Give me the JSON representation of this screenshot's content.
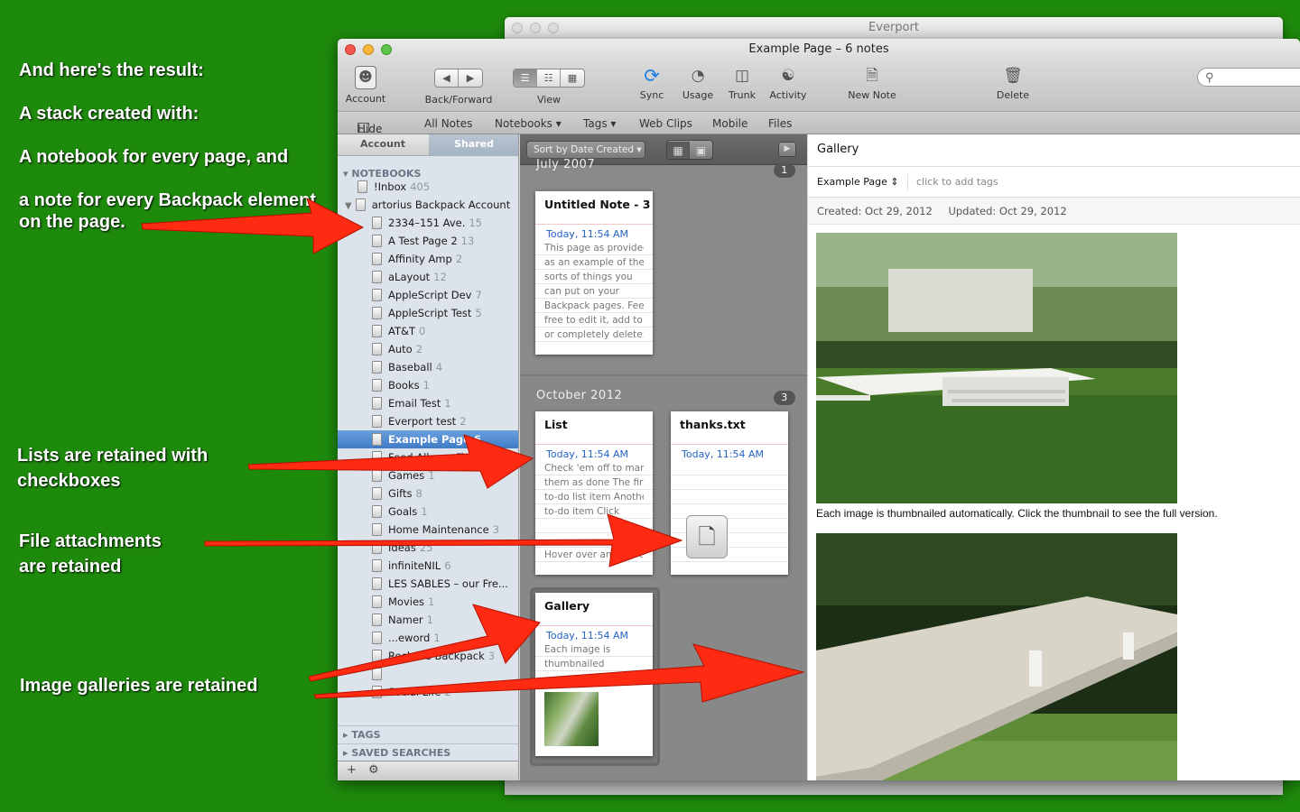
{
  "annotations": {
    "a1": "And here's the result:",
    "a2": "A stack created with:",
    "a3": "A notebook for every page, and",
    "a4": "a note for every Backpack element",
    "a4b": "on the page.",
    "a5": "Lists are retained with",
    "a5b": "checkboxes",
    "a6": "File attachments",
    "a6b": "are retained",
    "a7": "Image galleries are retained"
  },
  "bg_window": {
    "title": "Everport"
  },
  "window": {
    "title": "Example Page – 6 notes"
  },
  "toolbar": {
    "account": "Account",
    "backforward": "Back/Forward",
    "view": "View",
    "sync": "Sync",
    "usage": "Usage",
    "trunk": "Trunk",
    "activity": "Activity",
    "new_note": "New Note",
    "delete": "Delete"
  },
  "navbar": {
    "hide": "Hide",
    "all_notes": "All Notes",
    "notebooks": "Notebooks ▾",
    "tags": "Tags ▾",
    "web_clips": "Web Clips",
    "mobile": "Mobile",
    "files": "Files"
  },
  "sidebar": {
    "tab_account": "Account",
    "tab_shared": "Shared",
    "notebooks_header": "NOTEBOOKS",
    "tags_header": "TAGS",
    "saved_searches_header": "SAVED SEARCHES",
    "inbox": {
      "label": "!Inbox",
      "count": "405"
    },
    "stack": "artorius Backpack Account",
    "notebooks": [
      {
        "label": "2334–151 Ave.",
        "count": "15"
      },
      {
        "label": "A Test Page 2",
        "count": "13"
      },
      {
        "label": "Affinity Amp",
        "count": "2"
      },
      {
        "label": "aLayout",
        "count": "12"
      },
      {
        "label": "AppleScript Dev",
        "count": "7"
      },
      {
        "label": "AppleScript Test",
        "count": "5"
      },
      {
        "label": "AT&T",
        "count": "0"
      },
      {
        "label": "Auto",
        "count": "2"
      },
      {
        "label": "Baseball",
        "count": "4"
      },
      {
        "label": "Books",
        "count": "1"
      },
      {
        "label": "Email Test",
        "count": "1"
      },
      {
        "label": "Everport test",
        "count": "2"
      },
      {
        "label": "Example Page",
        "count": "6"
      },
      {
        "label": "Food Allergy Finder",
        "count": ""
      },
      {
        "label": "Games",
        "count": "1"
      },
      {
        "label": "Gifts",
        "count": "8"
      },
      {
        "label": "Goals",
        "count": "1"
      },
      {
        "label": "Home Maintenance",
        "count": "3"
      },
      {
        "label": "Ideas",
        "count": "25"
      },
      {
        "label": "infiniteNIL",
        "count": "6"
      },
      {
        "label": "LES SABLES – our Fre...",
        "count": ""
      },
      {
        "label": "Movies",
        "count": "1"
      },
      {
        "label": "Namer",
        "count": "1"
      },
      {
        "label": "...eword",
        "count": "1"
      },
      {
        "label": "Rocket's Backpack",
        "count": "3"
      },
      {
        "label": "",
        "count": ""
      },
      {
        "label": "Social Life",
        "count": "2"
      }
    ]
  },
  "notelist": {
    "sort": "Sort by Date Created",
    "groups": [
      {
        "label": "July 2007",
        "count": "1"
      },
      {
        "label": "October 2012",
        "count": "3"
      }
    ],
    "cards": [
      {
        "title": "Untitled Note - 3",
        "date": "Today, 11:54 AM",
        "body": [
          "This page as provided",
          "as an example of the",
          "sorts of things you",
          "can put on your",
          "Backpack pages. Feel",
          "free to edit it, add to it,",
          "or completely delete..."
        ]
      },
      {
        "title": "List",
        "date": "Today, 11:54 AM",
        "body": [
          "Check 'em off to mark",
          "them as done The first",
          "to-do list item Another",
          "to-do item Click",
          "",
          "",
          "Hover over an item t..."
        ]
      },
      {
        "title": "thanks.txt",
        "date": "Today, 11:54 AM",
        "body": []
      },
      {
        "title": "Gallery",
        "date": "Today, 11:54 AM",
        "body": [
          "Each image is",
          "thumbnailed"
        ]
      }
    ]
  },
  "note": {
    "title": "Gallery",
    "notebook": "Example Page",
    "tags_placeholder": "click to add tags",
    "created": "Created: Oct 29, 2012",
    "updated": "Updated: Oct 29, 2012",
    "caption": "Each image is thumbnailed automatically. Click the thumbnail to see the full version."
  },
  "colors": {
    "background": "#1e8a0c",
    "arrow": "#ff2a12",
    "selection": "#3f7bc7",
    "date": "#2463c8"
  }
}
